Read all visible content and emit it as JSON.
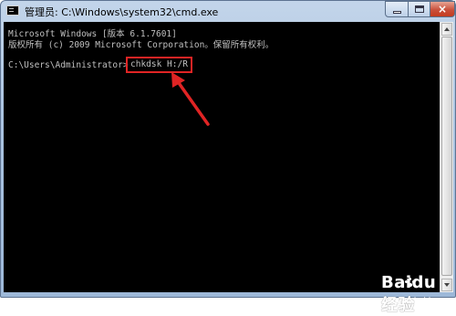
{
  "window": {
    "title": "管理员: C:\\Windows\\system32\\cmd.exe",
    "icon": "cmd-icon",
    "controls": {
      "minimize": "minimize-icon",
      "maximize": "maximize-icon",
      "close": "×"
    }
  },
  "console": {
    "lines": [
      "Microsoft Windows [版本 6.1.7601]",
      "版权所有 (c) 2009 Microsoft Corporation。保留所有权利。"
    ],
    "prompt": "C:\\Users\\Administrator>",
    "command": "chkdsk H:/R",
    "text_color": "#c0c0c0",
    "background": "#000000"
  },
  "annotation": {
    "highlight_color": "#e02424",
    "arrow": "red-arrow-icon"
  },
  "watermark": {
    "logo": "Baidu 经验",
    "url": "jingyan.baidu.com"
  }
}
